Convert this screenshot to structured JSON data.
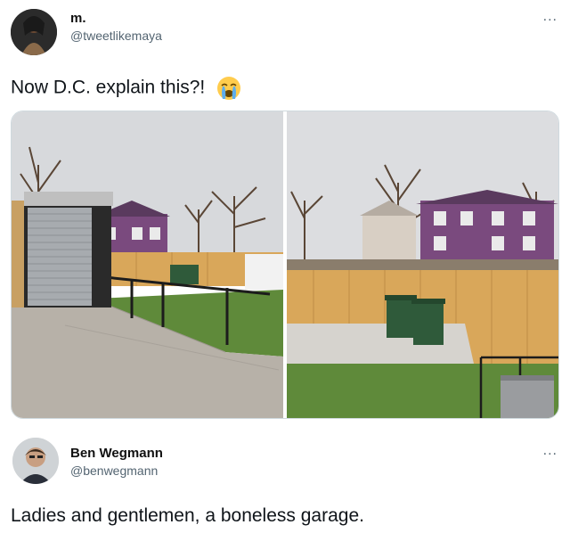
{
  "tweet1": {
    "display_name": "m.",
    "handle": "@tweetlikemaya",
    "text": "Now D.C. explain this?!",
    "emoji": "crying-face-emoji",
    "more": "..."
  },
  "tweet2": {
    "display_name": "Ben Wegmann",
    "handle": "@benwegmann",
    "text": "Ladies and gentlemen, a boneless garage.",
    "more": "..."
  },
  "colors": {
    "handle": "#536471",
    "border": "#cfd9de",
    "fence": "#d9a75a",
    "grass": "#5f8a3a",
    "house": "#7a4a7e"
  }
}
